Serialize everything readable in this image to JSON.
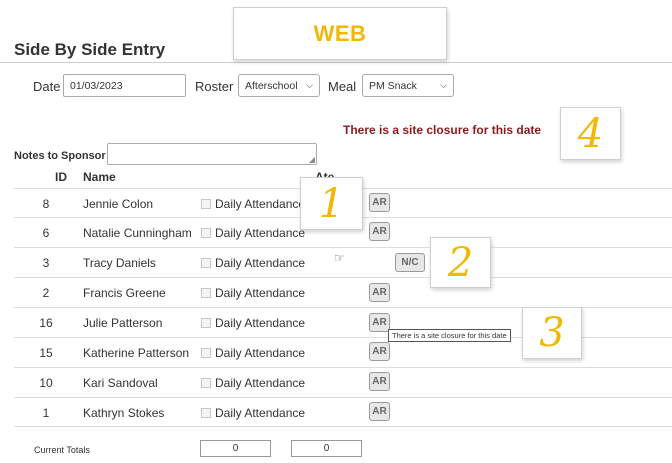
{
  "page_title": "Side By Side Entry",
  "header": {
    "date_label": "Date",
    "date_value": "01/03/2023",
    "roster_label": "Roster",
    "roster_value": "Afterschool",
    "meal_label": "Meal",
    "meal_value": "PM Snack"
  },
  "closure_message": "There is a site closure for this date",
  "notes_label": "Notes to Sponsor",
  "notes_value": "",
  "columns": {
    "id": "ID",
    "name": "Name",
    "ate": "Ate"
  },
  "attendance_label": "Daily Attendance",
  "rows": [
    {
      "id": "8",
      "name": "Jennie Colon",
      "button": "AR"
    },
    {
      "id": "6",
      "name": "Natalie Cunningham",
      "button": "AR"
    },
    {
      "id": "3",
      "name": "Tracy Daniels",
      "button": "N/C"
    },
    {
      "id": "2",
      "name": "Francis Greene",
      "button": "AR"
    },
    {
      "id": "16",
      "name": "Julie Patterson",
      "button": "AR"
    },
    {
      "id": "15",
      "name": "Katherine Patterson",
      "button": "AR"
    },
    {
      "id": "10",
      "name": "Kari Sandoval",
      "button": "AR"
    },
    {
      "id": "1",
      "name": "Kathryn Stokes",
      "button": "AR"
    }
  ],
  "tooltip_text": "There is a site closure for this date",
  "totals": {
    "label": "Current Totals",
    "value1": "0",
    "value2": "0"
  },
  "callouts": {
    "web": "WEB",
    "c1": "1",
    "c2": "2",
    "c3": "3",
    "c4": "4"
  },
  "colors": {
    "accent_callout": "#f2b705",
    "closure_text": "#8b1a1a"
  },
  "icons": {
    "cursor": "hand-cursor-icon",
    "dropdown": "chevron-down-icon"
  }
}
